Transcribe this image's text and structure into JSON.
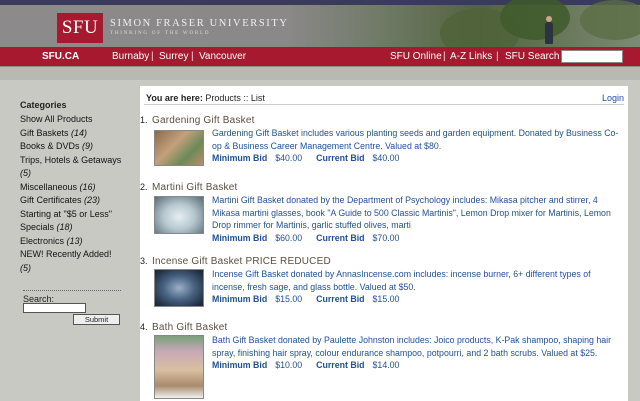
{
  "header": {
    "logo_text": "SFU",
    "university_name": "SIMON FRASER UNIVERSITY",
    "tagline": "THINKING OF THE WORLD"
  },
  "nav": {
    "home": "SFU.CA",
    "campuses": [
      "Burnaby",
      "Surrey",
      "Vancouver"
    ],
    "sfu_online": "SFU Online",
    "az_links": "A-Z Links",
    "sfu_search": "SFU Search",
    "separator": "|"
  },
  "sidebar": {
    "heading": "Categories",
    "categories": [
      {
        "label": "Show All Products",
        "count": ""
      },
      {
        "label": "Gift Baskets",
        "count": "(14)"
      },
      {
        "label": "Books & DVDs",
        "count": "(9)"
      },
      {
        "label": "Trips, Hotels & Getaways",
        "count": ""
      },
      {
        "label": "",
        "count": "(5)"
      },
      {
        "label": "Miscellaneous",
        "count": "(16)"
      },
      {
        "label": "Gift Certificates",
        "count": "(23)"
      },
      {
        "label": "Starting at \"$5 or Less\"",
        "count": ""
      },
      {
        "label": "Specials",
        "count": "(18)"
      },
      {
        "label": "Electronics",
        "count": "(13)"
      },
      {
        "label": "NEW! Recently Added!",
        "count": ""
      },
      {
        "label": "",
        "count": "(5)"
      }
    ],
    "search_label": "Search:",
    "submit_label": "Submit"
  },
  "main": {
    "breadcrumb_prefix": "You are here:",
    "breadcrumb_path": "Products :: List",
    "login": "Login",
    "min_bid_label": "Minimum Bid",
    "current_bid_label": "Current Bid",
    "products": [
      {
        "number": "1.",
        "title": "Gardening Gift Basket",
        "desc": "Gardening Gift Basket includes various planting seeds and garden equipment. Donated by Business Co-op & Business Career Management Centre. Valued at $80.",
        "min_bid": "$40.00",
        "current_bid": "$40.00"
      },
      {
        "number": "2.",
        "title": "Martini Gift Basket",
        "desc": "Martini Gift Basket donated by the Department of Psychology includes: Mikasa pitcher and stirrer, 4 Mikasa martini glasses, book \"A Guide to 500 Classic Martinis\", Lemon Drop mixer for Martinis, Lemon Drop rimmer for Martinis, garlic stuffed olives, marti",
        "min_bid": "$60.00",
        "current_bid": "$70.00"
      },
      {
        "number": "3.",
        "title": "Incense Gift Basket PRICE REDUCED",
        "desc": "Incense Gift Basket donated by AnnasIncense.com includes: incense burner, 6+ different types of incense, fresh sage, and glass bottle. Valued at $50.",
        "min_bid": "$15.00",
        "current_bid": "$15.00"
      },
      {
        "number": "4.",
        "title": "Bath Gift Basket",
        "desc": "Bath Gift Basket donated by Paulette Johnston includes: Joico products, K-Pak shampoo, shaping hair spray, finishing hair spray, colour endurance shampoo, potpourri, and 2 bath scrubs. Valued at $25.",
        "min_bid": "$10.00",
        "current_bid": "$14.00"
      }
    ]
  }
}
